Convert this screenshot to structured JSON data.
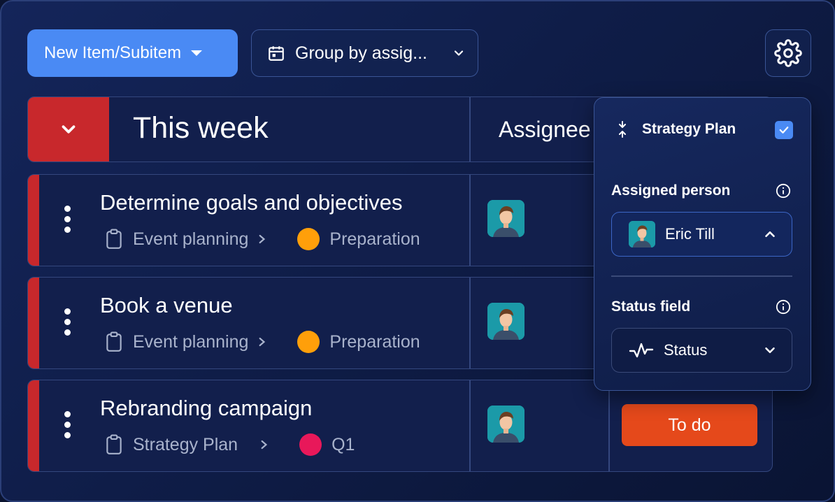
{
  "toolbar": {
    "new_item_label": "New Item/Subitem",
    "group_by_label": "Group by assig..."
  },
  "group": {
    "title": "This week",
    "column_assignee": "Assignee"
  },
  "rows": [
    {
      "title": "Determine goals and objectives",
      "project": "Event planning",
      "status": "Preparation",
      "status_color": "#ff9f0a"
    },
    {
      "title": "Book a venue",
      "project": "Event planning",
      "status": "Preparation",
      "status_color": "#ff9f0a"
    },
    {
      "title": "Rebranding campaign",
      "project": "Strategy Plan",
      "status": "Q1",
      "status_color": "#e8185a",
      "badge": "To do"
    }
  ],
  "popover": {
    "title": "Strategy Plan",
    "checked": true,
    "assigned_label": "Assigned person",
    "assigned_value": "Eric Till",
    "status_label": "Status field",
    "status_value": "Status"
  },
  "colors": {
    "accent": "#4a8af4",
    "group": "#c8282c",
    "todo": "#e5491b"
  }
}
